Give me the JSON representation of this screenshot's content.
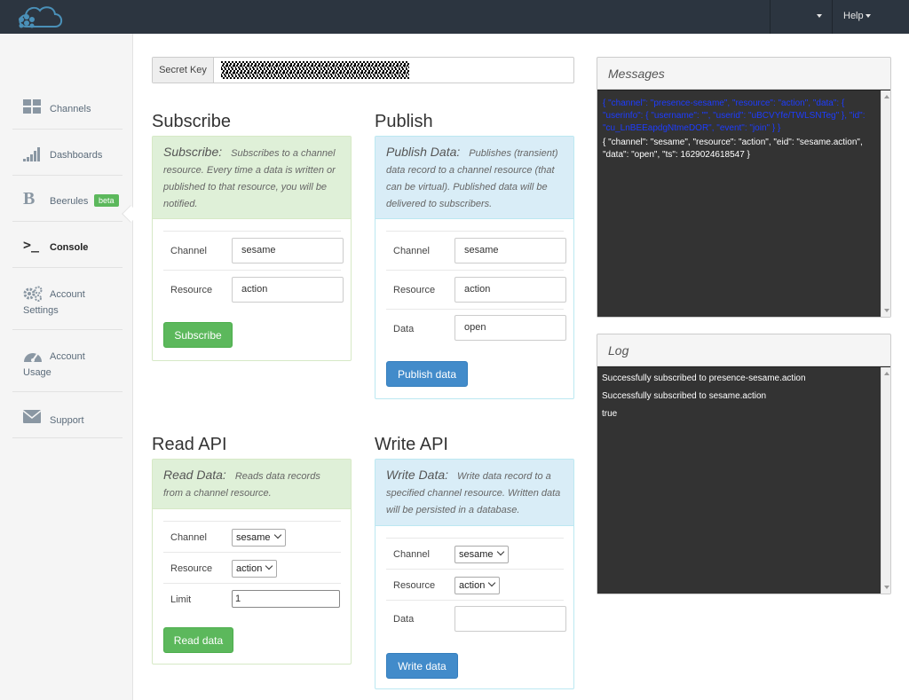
{
  "topbar": {
    "help_label": "Help"
  },
  "sidebar": {
    "items": [
      {
        "label": "Channels",
        "icon": "grid-icon"
      },
      {
        "label": "Dashboards",
        "icon": "signal-bars-icon"
      },
      {
        "label": "Beerules",
        "icon": "b-logo-icon",
        "badge": "beta"
      },
      {
        "label": "Console",
        "icon": "terminal-icon",
        "active": true
      },
      {
        "label": "Account",
        "label2": "Settings",
        "icon": "gears-icon"
      },
      {
        "label": "Account",
        "label2": "Usage",
        "icon": "gauge-icon"
      },
      {
        "label": "Support",
        "icon": "envelope-icon"
      }
    ]
  },
  "secret_key": {
    "label": "Secret Key"
  },
  "subscribe": {
    "title": "Subscribe",
    "head_title": "Subscribe:",
    "head_desc": "Subscribes to a channel resource. Every time a data is written or published to that resource, you will be notified.",
    "channel_label": "Channel",
    "channel_value": "sesame",
    "resource_label": "Resource",
    "resource_value": "action",
    "button": "Subscribe"
  },
  "publish": {
    "title": "Publish",
    "head_title": "Publish Data:",
    "head_desc": "Publishes (transient) data record to a channel resource (that can be virtual). Published data will be delivered to subscribers.",
    "channel_label": "Channel",
    "channel_value": "sesame",
    "resource_label": "Resource",
    "resource_value": "action",
    "data_label": "Data",
    "data_value": "open",
    "button": "Publish data"
  },
  "read": {
    "title": "Read API",
    "head_title": "Read Data:",
    "head_desc": "Reads data records from a channel resource.",
    "channel_label": "Channel",
    "channel_value": "sesame",
    "resource_label": "Resource",
    "resource_value": "action",
    "limit_label": "Limit",
    "limit_value": "1",
    "button": "Read data"
  },
  "write": {
    "title": "Write API",
    "head_title": "Write Data:",
    "head_desc": "Write data record to a specified channel resource. Written data will be persisted in a database.",
    "channel_label": "Channel",
    "channel_value": "sesame",
    "resource_label": "Resource",
    "resource_value": "action",
    "data_label": "Data",
    "data_value": "",
    "button": "Write data"
  },
  "messages": {
    "title": "Messages",
    "line1": "{ \"channel\": \"presence-sesame\", \"resource\": \"action\", \"data\": { \"userinfo\": { \"username\": \"\", \"userid\": \"uBCVYfe/TWLSNTeg\" }, \"id\": \"cu_LnBEEapdgNtmeDOR\", \"event\": \"join\" } }",
    "line2": "{ \"channel\": \"sesame\", \"resource\": \"action\", \"eid\": \"sesame.action\", \"data\": \"open\", \"ts\": 1629024618547 }",
    "colors": {
      "highlight": "#1d3cff",
      "text": "#ffffff"
    }
  },
  "log": {
    "title": "Log",
    "lines": [
      "Successfully subscribed to presence-sesame.action",
      "Successfully subscribed to sesame.action",
      "true"
    ]
  },
  "colors": {
    "topbar": "#2c3540",
    "green": "#5cb85c",
    "blue": "#428bca",
    "console_bg": "#333333"
  }
}
